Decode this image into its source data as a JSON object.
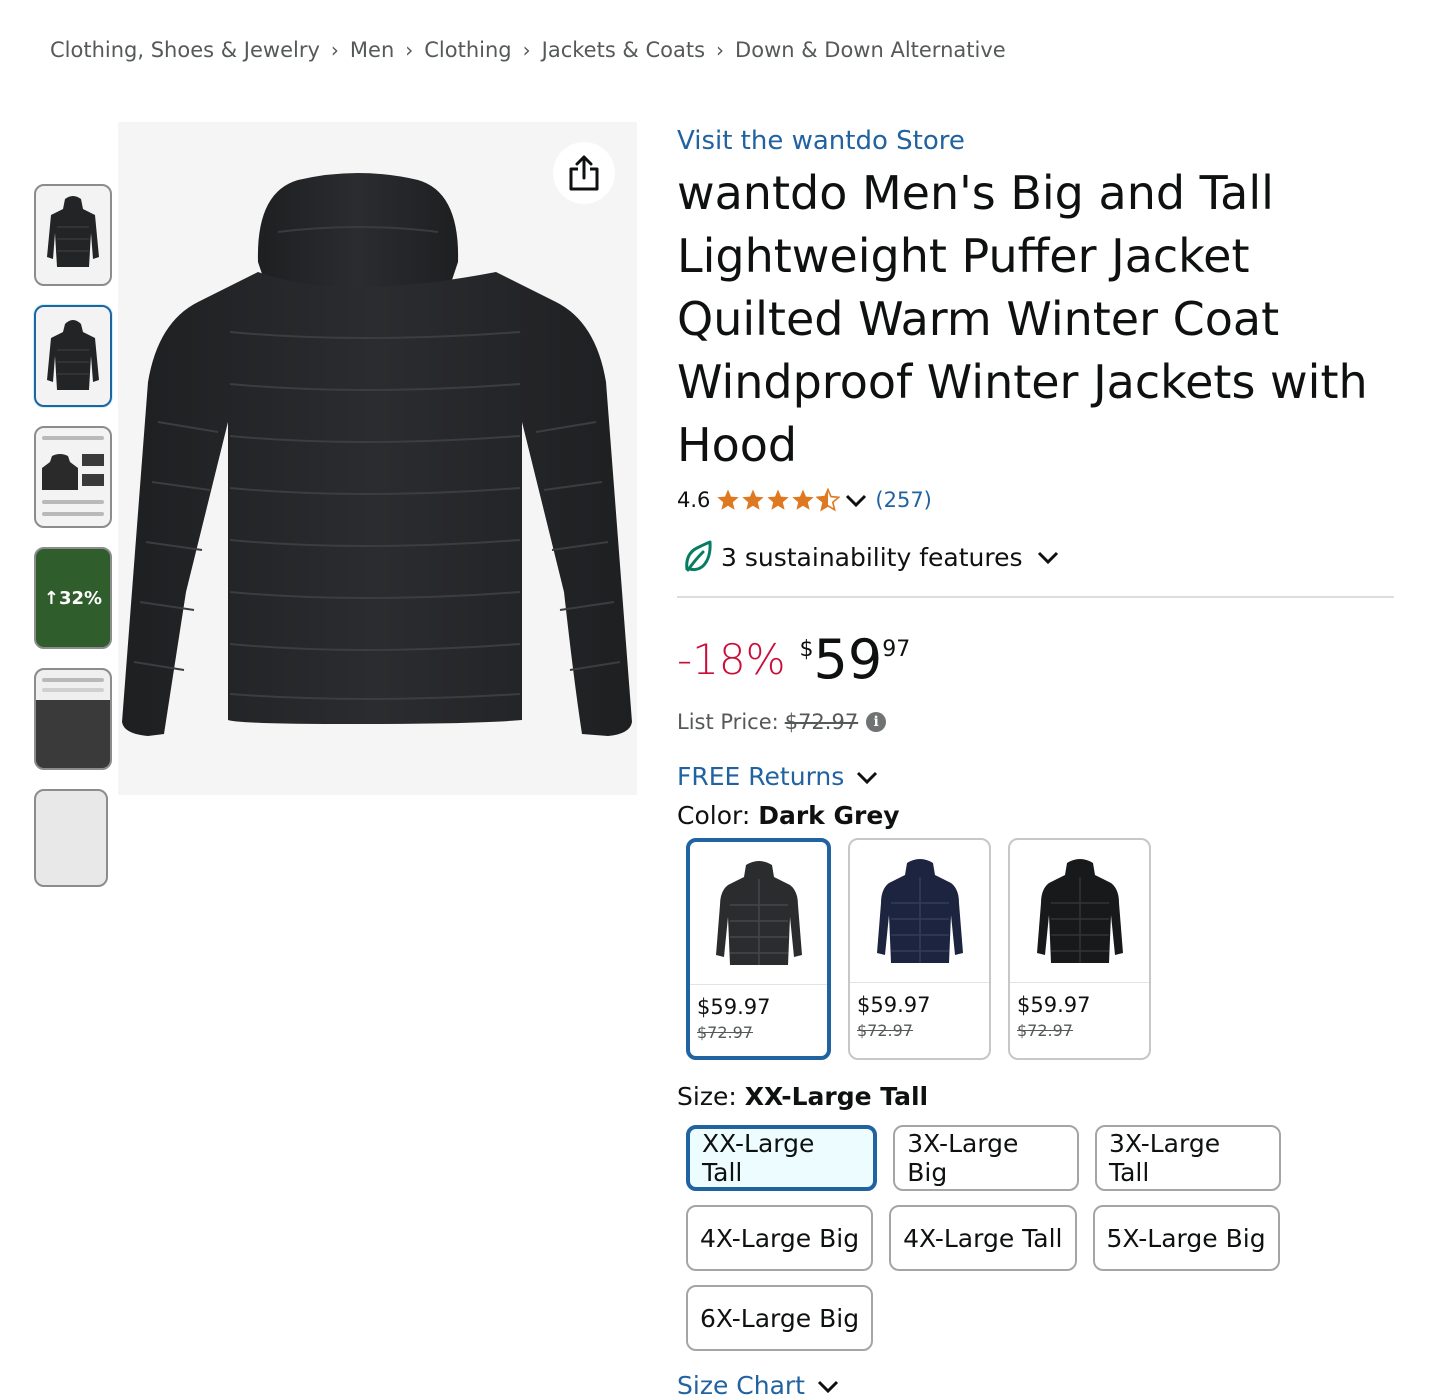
{
  "breadcrumb": [
    "Clothing, Shoes & Jewelry",
    "Men",
    "Clothing",
    "Jackets & Coats",
    "Down & Down Alternative"
  ],
  "breadcrumb_separator": "›",
  "thumbnails": {
    "count": 6,
    "selected_index": 1,
    "promo_text": "↑32%"
  },
  "product": {
    "store_link": "Visit the wantdo Store",
    "title": "wantdo Men's Big and Tall Lightweight Puffer Jacket Quilted Warm Winter Coat Windproof Winter Jackets with Hood",
    "rating": "4.6",
    "rating_stars": 4.5,
    "rating_count": "(257)",
    "sustainability": "3 sustainability features"
  },
  "price": {
    "discount": "-18%",
    "currency": "$",
    "whole": "59",
    "fraction": "97",
    "list_price_label": "List Price:",
    "list_price": "$72.97"
  },
  "returns": "FREE Returns",
  "color": {
    "label": "Color:",
    "selected": "Dark Grey",
    "options": [
      {
        "price": "$59.97",
        "old_price": "$72.97",
        "color": "#2b2c2e"
      },
      {
        "price": "$59.97",
        "old_price": "$72.97",
        "color": "#1d2440"
      },
      {
        "price": "$59.97",
        "old_price": "$72.97",
        "color": "#18191a"
      }
    ]
  },
  "size": {
    "label": "Size:",
    "selected": "XX-Large Tall",
    "options": [
      "XX-Large Tall",
      "3X-Large Big",
      "3X-Large Tall",
      "4X-Large Big",
      "4X-Large Tall",
      "5X-Large Big",
      "6X-Large Big"
    ]
  },
  "size_chart": "Size Chart",
  "colors": {
    "link": "#2162a1",
    "discount": "#cc0c39",
    "star": "#de7921",
    "selected_border": "#2162a1",
    "leaf": "#067d62"
  }
}
